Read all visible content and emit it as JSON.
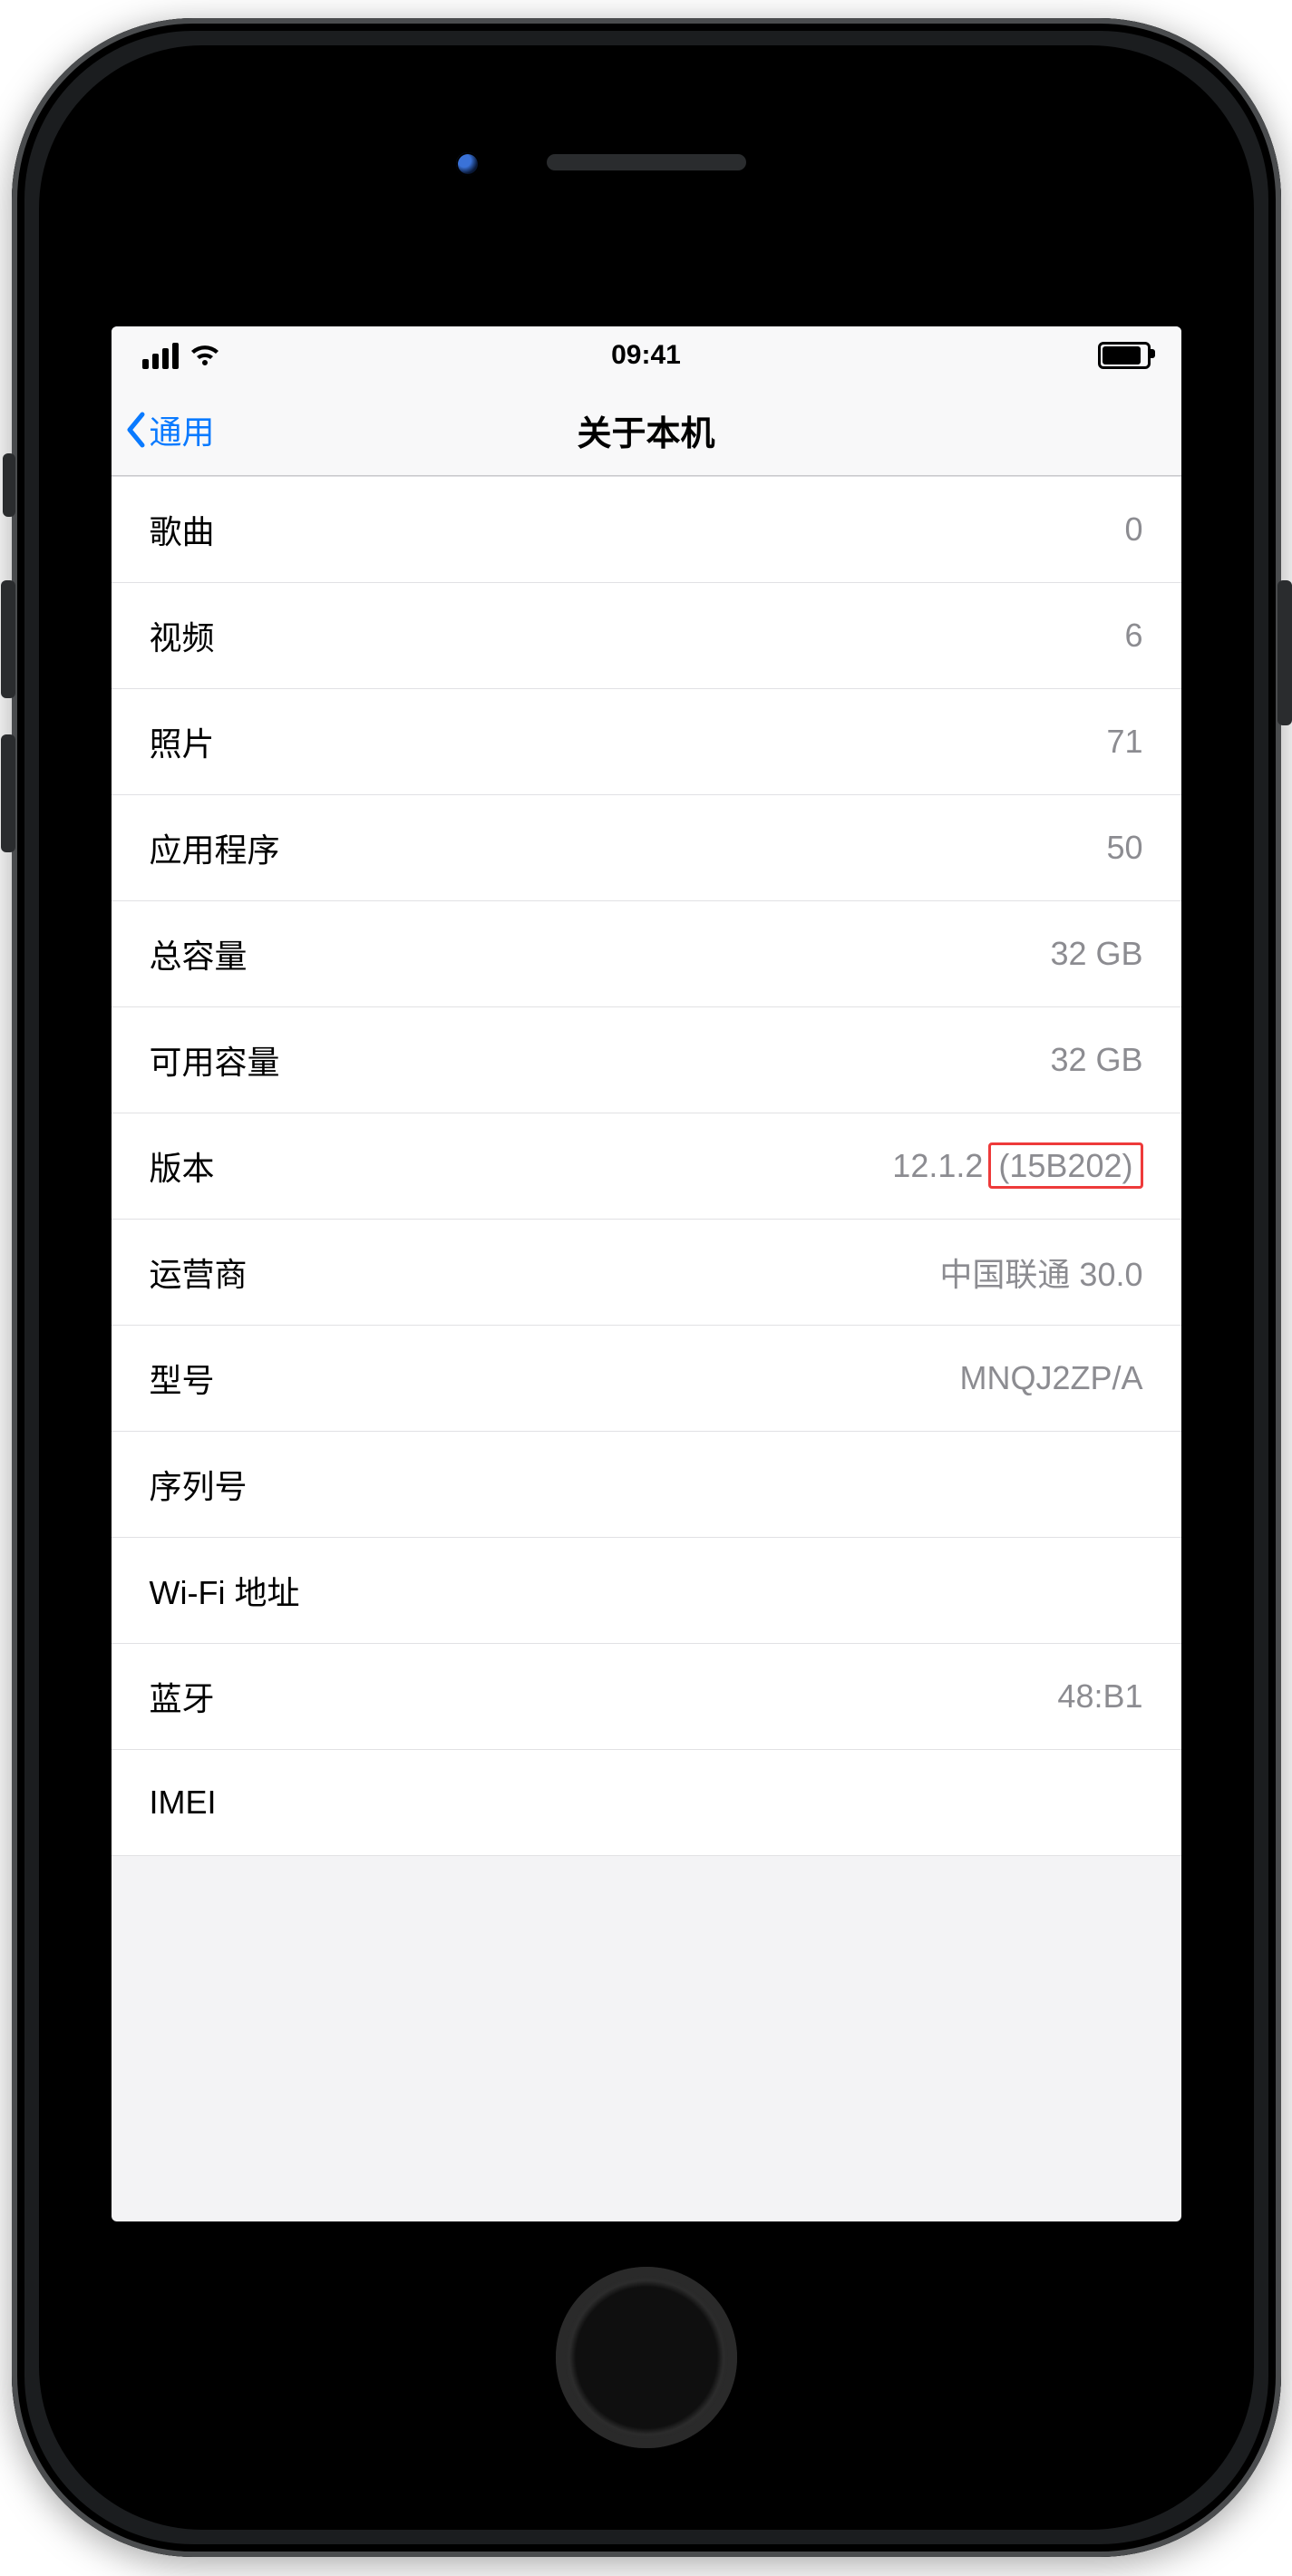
{
  "status": {
    "time": "09:41"
  },
  "nav": {
    "back": "通用",
    "title": "关于本机"
  },
  "rows": [
    {
      "label": "歌曲",
      "value": "0"
    },
    {
      "label": "视频",
      "value": "6"
    },
    {
      "label": "照片",
      "value": "71"
    },
    {
      "label": "应用程序",
      "value": "50"
    },
    {
      "label": "总容量",
      "value": "32 GB"
    },
    {
      "label": "可用容量",
      "value": "32 GB"
    },
    {
      "label": "版本",
      "value": "12.1.2",
      "highlight": "(15B202)"
    },
    {
      "label": "运营商",
      "value": "中国联通 30.0"
    },
    {
      "label": "型号",
      "value": "MNQJ2ZP/A"
    },
    {
      "label": "序列号",
      "value": ""
    },
    {
      "label": "Wi-Fi 地址",
      "value": ""
    },
    {
      "label": "蓝牙",
      "value": "48:B1"
    },
    {
      "label": "IMEI",
      "value": ""
    }
  ]
}
